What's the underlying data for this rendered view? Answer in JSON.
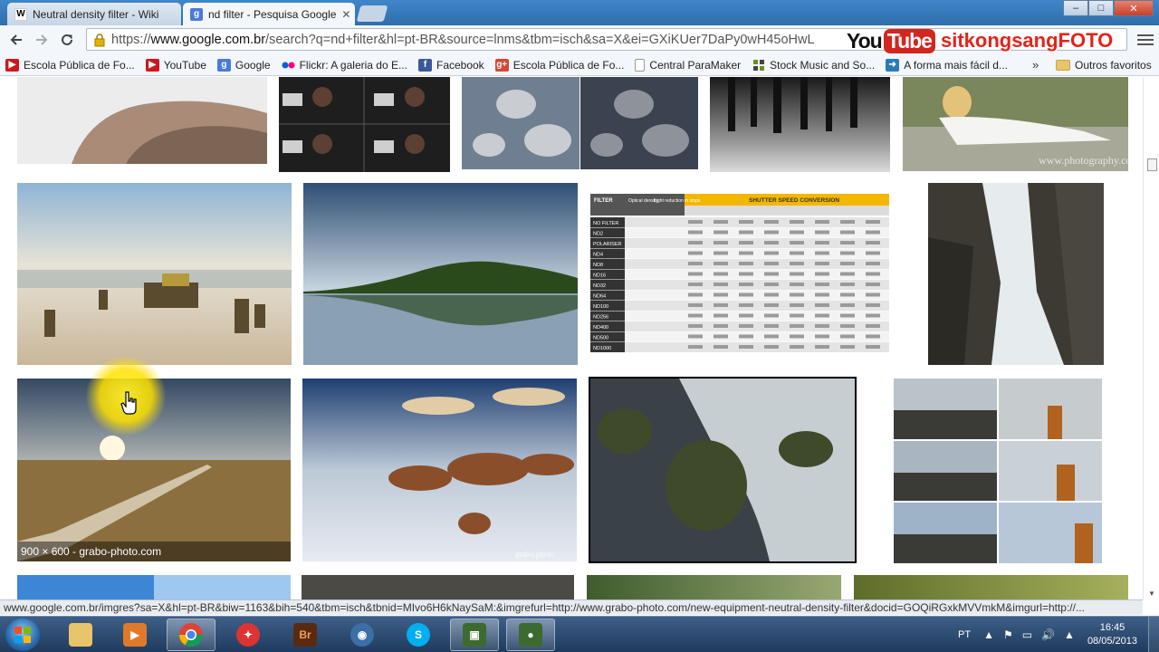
{
  "tabs": [
    {
      "title": "Neutral density filter - Wiki",
      "favicon": "W",
      "state": "inactive"
    },
    {
      "title": "nd filter - Pesquisa Google",
      "favicon": "g",
      "state": "active"
    }
  ],
  "window_controls": {
    "minimize": "–",
    "maximize": "□",
    "close": "✕"
  },
  "address_bar": {
    "scheme": "https://",
    "host": "www.google.com.br",
    "path": "/search?q=nd+filter&hl=pt-BR&source=lnms&tbm=isch&sa=X&ei=GXiKUer7DaPy0wH45oHwL"
  },
  "overlay": {
    "you": "You",
    "tube": "Tube",
    "channel": "sitkongsangFOTO"
  },
  "bookmarks": [
    {
      "label": "Escola Pública de Fo...",
      "icon": "youtube-icon",
      "color": "#cc181e"
    },
    {
      "label": "YouTube",
      "icon": "youtube-icon",
      "color": "#cc181e"
    },
    {
      "label": "Google",
      "icon": "google-icon",
      "color": "#4a7bd9"
    },
    {
      "label": "Flickr: A galeria do E...",
      "icon": "flickr-icon",
      "color": "#ff0084"
    },
    {
      "label": "Facebook",
      "icon": "facebook-icon",
      "color": "#3b5998"
    },
    {
      "label": "Escola Pública de Fo...",
      "icon": "google-plus-icon",
      "color": "#d34836"
    },
    {
      "label": "Central ParaMaker",
      "icon": "page-icon",
      "color": "#ffffff"
    },
    {
      "label": "Stock Music and So...",
      "icon": "grid-icon",
      "color": "#6b8e23"
    },
    {
      "label": "A forma mais fácil d...",
      "icon": "arrow-icon",
      "color": "#2a7ab8"
    }
  ],
  "bookmarks_more": "»",
  "other_bookmarks": "Outros favoritos",
  "hover_caption": "900 × 600 - grabo-photo.com",
  "status_url": "www.google.com.br/imgres?sa=X&hl=pt-BR&biw=1163&bih=540&tbm=isch&tbnid=MIvo6H6kNaySaM:&imgrefurl=http://www.grabo-photo.com/new-equipment-neutral-density-filter&docid=GOQiRGxkMVVmkM&imgurl=http://...",
  "nd_table": {
    "header": [
      "FILTER",
      "Optical density",
      "Light reduction in stops"
    ],
    "banner": "SHUTTER SPEED CONVERSION",
    "rows": [
      "NO FILTER",
      "ND2",
      "POLARISER",
      "ND4",
      "ND8",
      "ND16",
      "ND32",
      "ND64",
      "ND100",
      "ND256",
      "ND400",
      "ND500",
      "ND1000"
    ]
  },
  "image_watermarks": {
    "model": "www.photography.com",
    "beach": "grabo.photo"
  },
  "taskbar": {
    "apps": [
      {
        "name": "explorer",
        "label": ""
      },
      {
        "name": "media-player",
        "label": ""
      },
      {
        "name": "chrome",
        "label": ""
      },
      {
        "name": "app-red",
        "label": ""
      },
      {
        "name": "bridge",
        "label": "Br"
      },
      {
        "name": "dvd-app",
        "label": ""
      },
      {
        "name": "skype",
        "label": "S"
      },
      {
        "name": "camtasia",
        "label": ""
      },
      {
        "name": "recorder",
        "label": ""
      }
    ],
    "language": "PT",
    "time": "16:45",
    "date": "08/05/2013"
  }
}
